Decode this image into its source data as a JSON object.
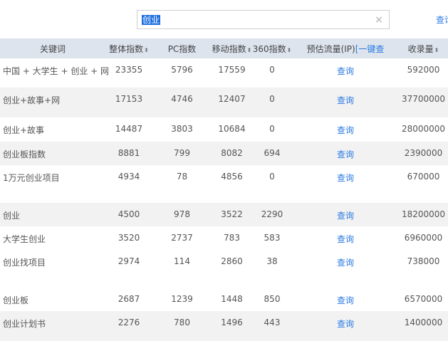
{
  "search": {
    "value": "创业",
    "clear_icon": "×",
    "button_label": "查询"
  },
  "table": {
    "headers": {
      "keyword": "关键词",
      "total": "整体指数",
      "pc": "PC指数",
      "mobile": "移动指数",
      "idx360": "360指数",
      "traffic": "预估流量(IP)",
      "traffic_link": "[一键查",
      "indexed": "收录量"
    },
    "sort_icon": "⬍",
    "rows": [
      {
        "keyword": "中国 + 大学生 + 创业 + 网",
        "total": "23355",
        "pc": "5796",
        "mobile": "17559",
        "idx360": "0",
        "action": "查询",
        "indexed": "592000"
      },
      {
        "keyword": "创业+故事+网",
        "total": "17153",
        "pc": "4746",
        "mobile": "12407",
        "idx360": "0",
        "action": "查询",
        "indexed": "37700000"
      },
      {
        "keyword": "创业+故事",
        "total": "14487",
        "pc": "3803",
        "mobile": "10684",
        "idx360": "0",
        "action": "查询",
        "indexed": "28000000"
      },
      {
        "keyword": "创业板指数",
        "total": "8881",
        "pc": "799",
        "mobile": "8082",
        "idx360": "694",
        "action": "查询",
        "indexed": "2390000"
      },
      {
        "keyword": "1万元创业项目",
        "total": "4934",
        "pc": "78",
        "mobile": "4856",
        "idx360": "0",
        "action": "查询",
        "indexed": "670000"
      },
      {
        "keyword": "创业",
        "total": "4500",
        "pc": "978",
        "mobile": "3522",
        "idx360": "2290",
        "action": "查询",
        "indexed": "18200000"
      },
      {
        "keyword": "大学生创业",
        "total": "3520",
        "pc": "2737",
        "mobile": "783",
        "idx360": "583",
        "action": "查询",
        "indexed": "6960000"
      },
      {
        "keyword": "创业找项目",
        "total": "2974",
        "pc": "114",
        "mobile": "2860",
        "idx360": "38",
        "action": "查询",
        "indexed": "738000"
      },
      {
        "keyword": "创业板",
        "total": "2687",
        "pc": "1239",
        "mobile": "1448",
        "idx360": "850",
        "action": "查询",
        "indexed": "6570000"
      },
      {
        "keyword": "创业计划书",
        "total": "2276",
        "pc": "780",
        "mobile": "1496",
        "idx360": "443",
        "action": "查询",
        "indexed": "1400000"
      }
    ]
  }
}
